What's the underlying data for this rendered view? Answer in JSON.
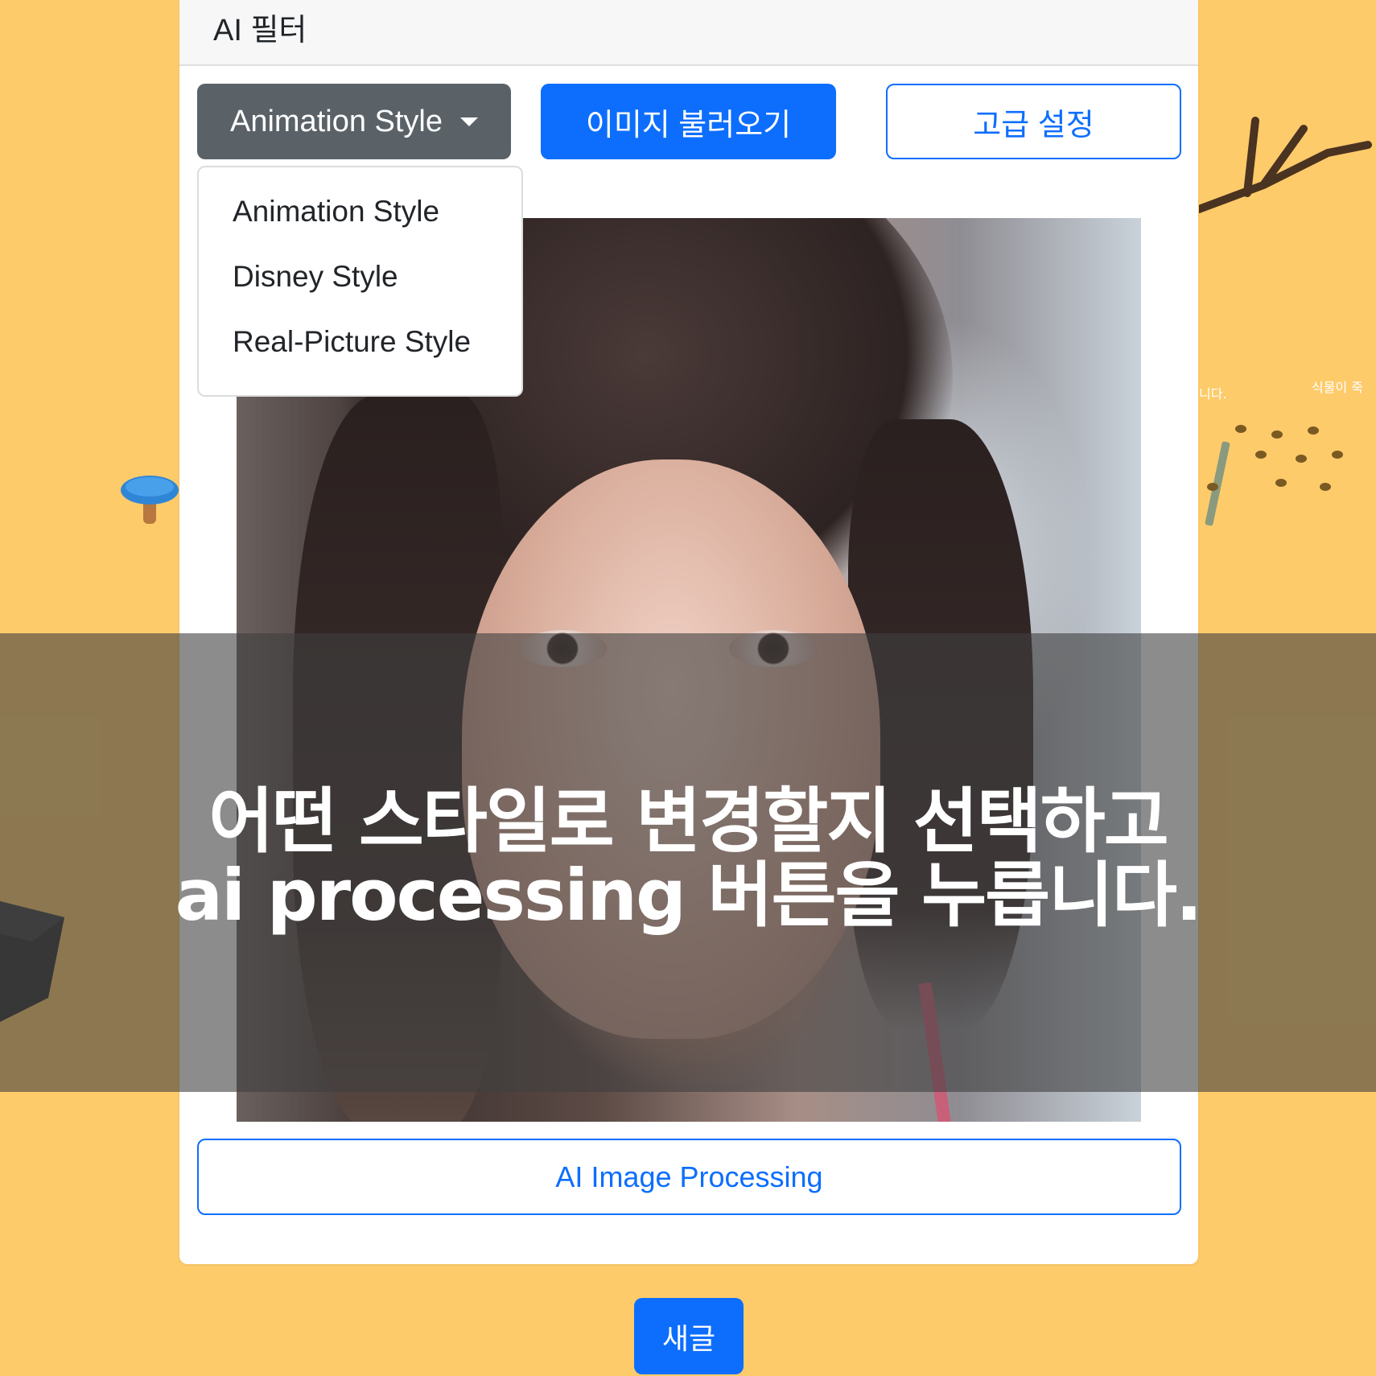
{
  "card": {
    "title": "AI 필터"
  },
  "toolbar": {
    "style_select_label": "Animation Style",
    "load_image_label": "이미지 불러오기",
    "advanced_label": "고급 설정"
  },
  "dropdown": {
    "items": [
      "Animation Style",
      "Disney Style",
      "Real-Picture Style"
    ]
  },
  "process_button_label": "AI Image Processing",
  "new_post_label": "새글",
  "caption": {
    "line1": "어떤 스타일로 변경할지 선택하고",
    "line2": "ai processing 버튼을 누릅니다."
  },
  "background_text": {
    "left": "니다.",
    "right": "식물이 죽"
  },
  "colors": {
    "background": "#FECB6A",
    "primary": "#0D6EFD",
    "secondary": "#5A6268"
  }
}
